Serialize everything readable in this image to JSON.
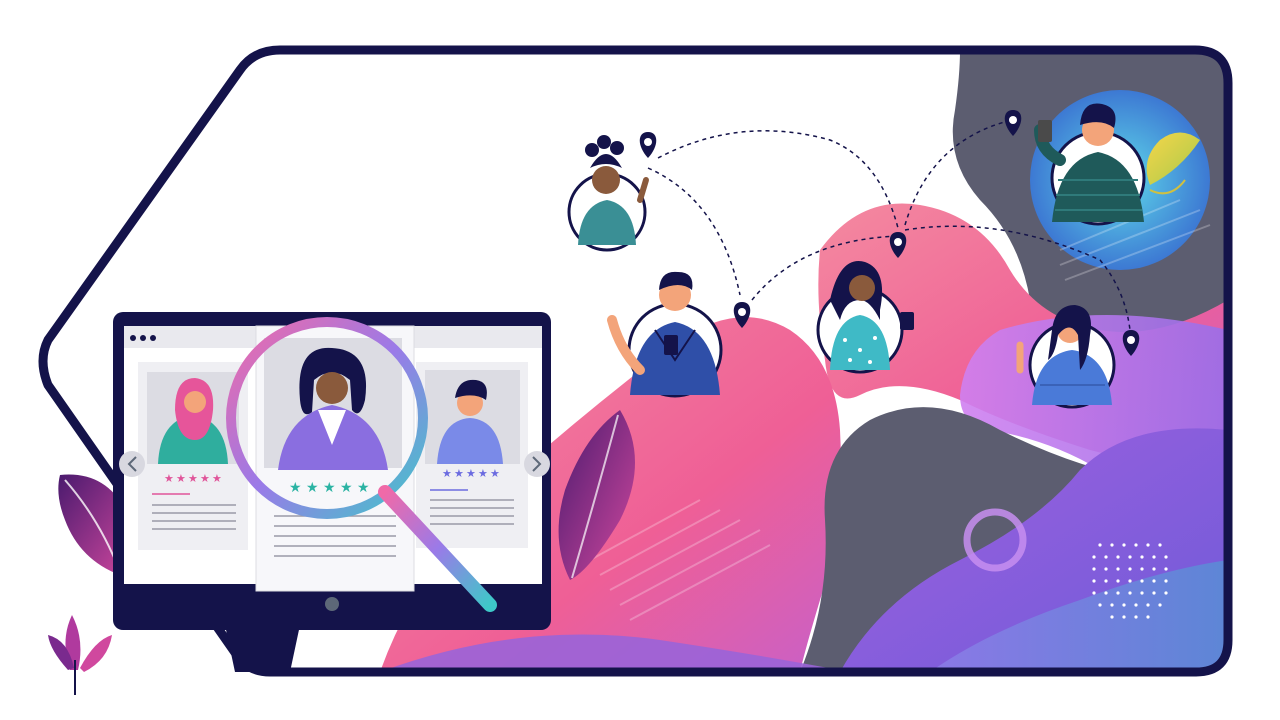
{
  "colors": {
    "frame": "#14134a",
    "pink": "#f0608f",
    "purple": "#8a55d6",
    "violet": "#b06ae0",
    "teal": "#3fc6c1",
    "gray": "#5b5c6e",
    "blue_glow": "#4fc3e8",
    "star_pink": "#e0559a",
    "star_teal": "#2bb3a3",
    "star_blue": "#6b6be0"
  },
  "icons": [
    "location-pin-icon",
    "magnifier-icon",
    "chevron-left-icon",
    "chevron-right-icon",
    "star-icon",
    "window-dots-icon"
  ],
  "profile_cards": [
    {
      "name": "profile-card-left",
      "stars": 5
    },
    {
      "name": "profile-card-center",
      "stars": 5
    },
    {
      "name": "profile-card-right",
      "stars": 5
    }
  ]
}
